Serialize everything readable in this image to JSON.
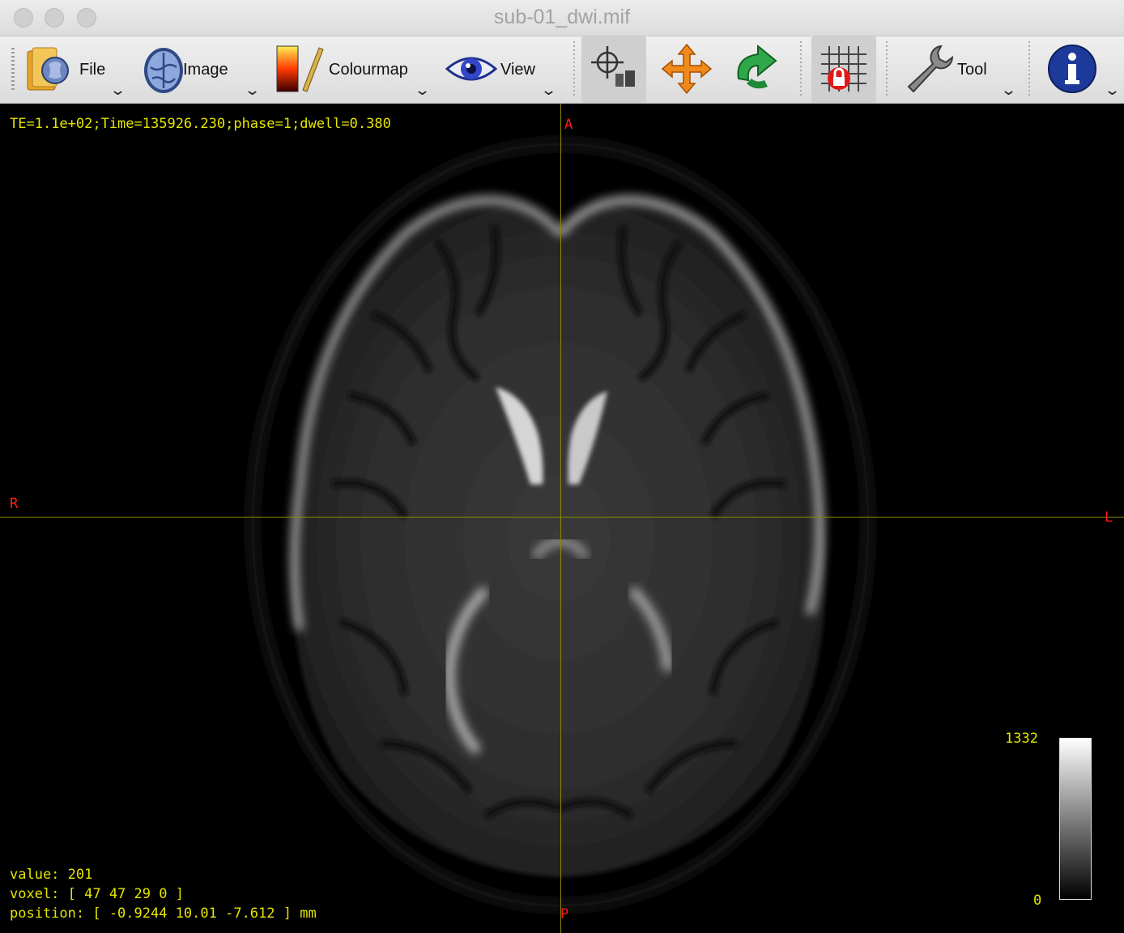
{
  "window": {
    "title": "sub-01_dwi.mif"
  },
  "toolbar": {
    "file_label": "File",
    "image_label": "Image",
    "colourmap_label": "Colourmap",
    "view_label": "View",
    "tool_label": "Tool",
    "buttons": [
      "folder-icon",
      "brain-image-icon",
      "colourmap-icon",
      "eye-icon",
      "focus-crosshair-icon",
      "move-arrows-icon",
      "rotate-arrow-icon",
      "lock-grid-icon",
      "wrench-icon",
      "info-icon"
    ]
  },
  "viewer": {
    "header_info": "TE=1.1e+02;Time=135926.230;phase=1;dwell=0.380",
    "orientation": {
      "anterior": "A",
      "posterior": "P",
      "right": "R",
      "left": "L"
    },
    "value_line": "value: 201",
    "voxel_line": "voxel: [ 47 47 29 0 ]",
    "position_line": "position: [ -0.9244 10.01 -7.612 ] mm",
    "colourbar": {
      "max": "1332",
      "min": "0"
    }
  },
  "colors": {
    "overlay_text": "#e5e500",
    "orientation_labels": "#ff1a1a",
    "crosshair": "#8a8a00"
  }
}
